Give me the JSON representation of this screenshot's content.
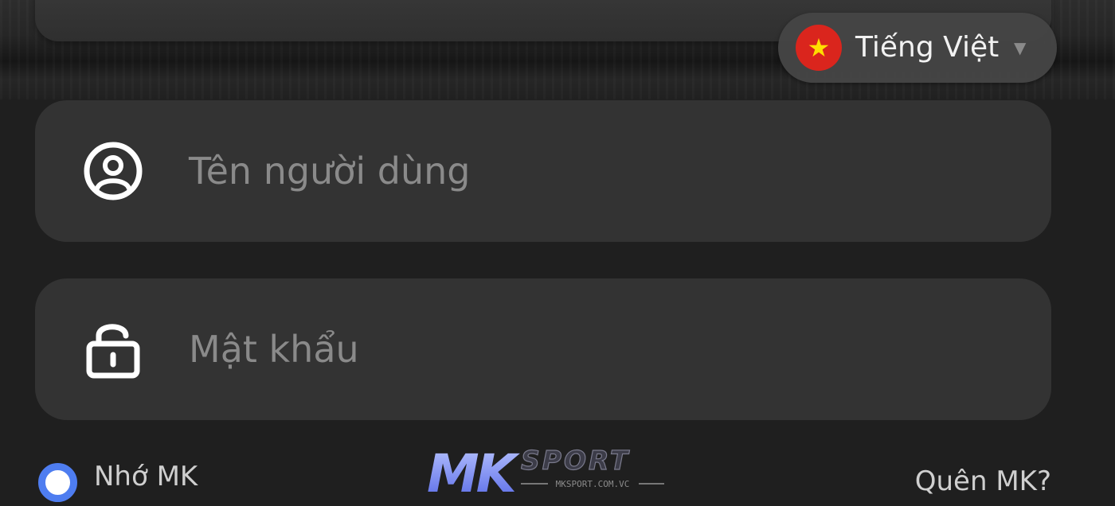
{
  "language": {
    "label": "Tiếng Việt",
    "flag_icon": "vietnam-flag-icon",
    "flag_color": "#da251d",
    "star_color": "#ffde00"
  },
  "username": {
    "placeholder": "Tên người dùng",
    "icon": "user-circle-icon"
  },
  "password": {
    "placeholder": "Mật khẩu",
    "icon": "padlock-icon"
  },
  "remember": {
    "label": "Nhớ MK",
    "radio_color": "#4e7df0"
  },
  "logo": {
    "mark": "MK",
    "word": "SPORT",
    "domain": "MKSPORT.COM.VC"
  },
  "forgot": {
    "label": "Quên MK?"
  }
}
